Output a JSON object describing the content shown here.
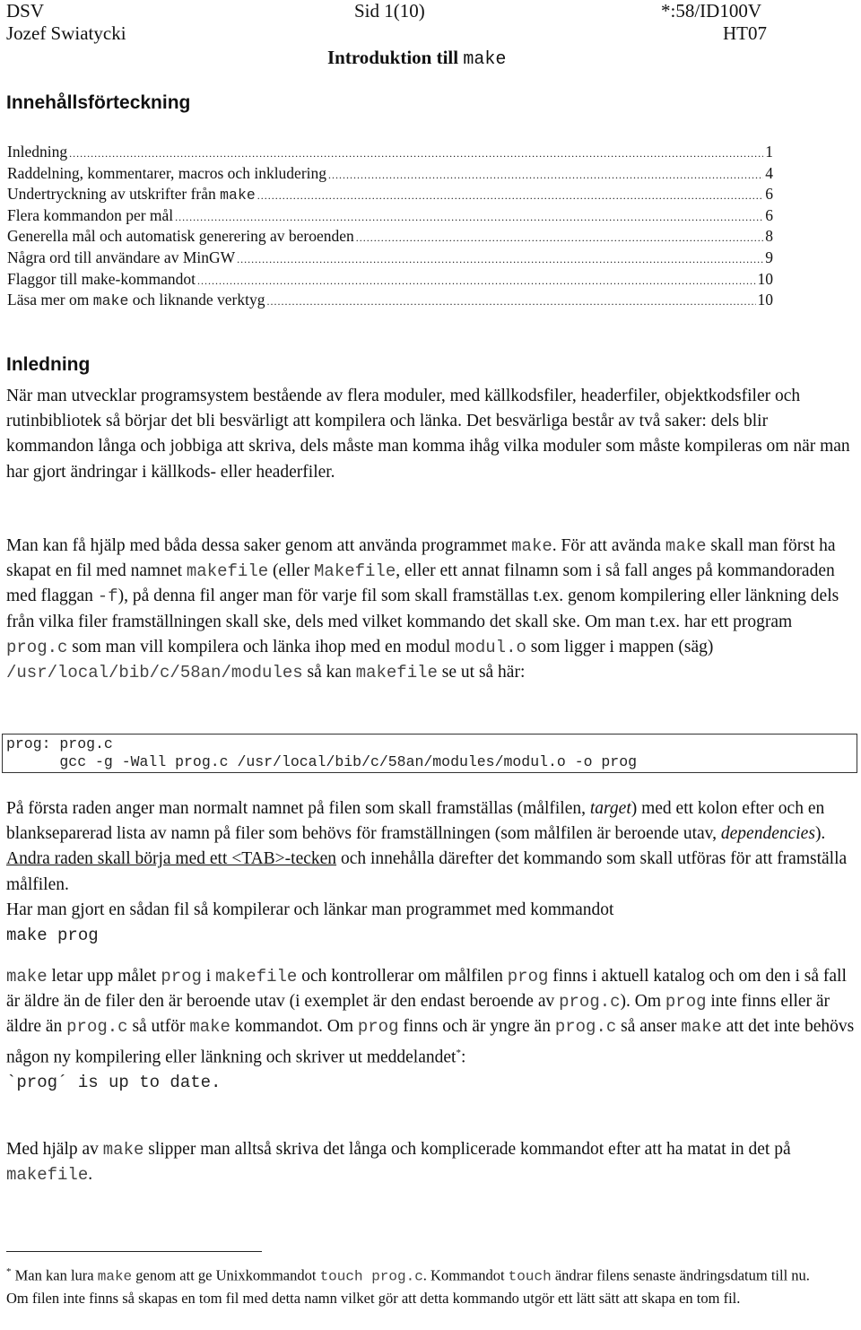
{
  "header": {
    "left_line1": "DSV",
    "center_line1": "Sid 1(10)",
    "right_line1": "*:58/ID100V",
    "left_line2": "Jozef Swiatycki",
    "right_line2": "HT07",
    "title_text": "Introduktion till ",
    "title_code": "make"
  },
  "toc": {
    "heading": "Innehållsförteckning",
    "dots": "..................................................................................................................................................................................................................................................",
    "items": [
      {
        "label": "Inledning",
        "page": "1"
      },
      {
        "label": "Raddelning, kommentarer, macros och inkludering",
        "page": "4"
      },
      {
        "label_pre": "Undertryckning av utskrifter från ",
        "label_code": "make",
        "page": "6"
      },
      {
        "label": "Flera kommandon per mål",
        "page": "6"
      },
      {
        "label": "Generella mål och automatisk generering av beroenden",
        "page": "8"
      },
      {
        "label": "Några ord till användare av MinGW",
        "page": "9"
      },
      {
        "label": "Flaggor till make-kommandot",
        "page": "10"
      },
      {
        "label_pre": "Läsa mer om ",
        "label_code": "make",
        "label_post": " och liknande verktyg",
        "page": "10"
      }
    ]
  },
  "section": {
    "heading": "Inledning",
    "p1": "När man utvecklar programsystem bestående av flera moduler, med källkodsfiler, headerfiler, objektkodsfiler och rutinbibliotek så börjar det bli besvärligt att kompilera och länka. Det besvärliga består av två saker: dels blir kommandon långa och jobbiga att skriva, dels måste man komma ihåg vilka moduler som måste kompileras om när man har gjort ändringar i källkods- eller headerfiler.",
    "p2": {
      "t1": "Man kan få hjälp med båda dessa saker genom att använda programmet ",
      "c1": "make",
      "t2": ". För att avända ",
      "c2": "make",
      "t3": " skall man först ha skapat en fil med namnet ",
      "c3": "makefile",
      "t4": " (eller ",
      "c4": "Makefile",
      "t5": ", eller ett annat filnamn som i så fall anges på kommandoraden med flaggan ",
      "c5": "-f",
      "t6": "),  på denna fil anger man för varje fil som skall framställas t.ex. genom kompilering eller länkning dels från vilka filer framställningen skall ske, dels med vilket kommando det skall ske. Om man t.ex. har ett program ",
      "c6": "prog.c",
      "t7": " som man vill kompilera och länka ihop med en modul ",
      "c7": "modul.o",
      "t8": " som ligger i mappen (säg) ",
      "c8": "/usr/local/bib/c/58an/modules",
      "t9": " så kan ",
      "c9": "makefile",
      "t10": " se ut så här:"
    },
    "code_lines": [
      "prog: prog.c",
      "      gcc -g -Wall prog.c /usr/local/bib/c/58an/modules/modul.o -o prog"
    ],
    "p3": {
      "t1": "På första raden anger man normalt namnet på filen som skall framställas (målfilen, ",
      "i1": "target",
      "t2": ") med ett kolon efter och en blankseparerad lista av namn på filer som behövs för framställningen (som målfilen är beroende utav, ",
      "i2": "dependencies",
      "t3": "). ",
      "u1": "Andra raden skall börja med ett <TAB>-tecken",
      "t4": " och innehålla därefter det kommando som skall utföras för att framställa målfilen.",
      "t5": "Har man gjort en sådan fil så kompilerar och länkar man programmet med kommandot",
      "cmd": "make prog"
    },
    "p4": {
      "c1": "make",
      "t1": " letar upp målet ",
      "c2": "prog",
      "t2": " i ",
      "c3": "makefile",
      "t3": " och kontrollerar om målfilen ",
      "c4": "prog",
      "t4": " finns i aktuell katalog och om den i så fall är äldre än de filer den är beroende utav (i exemplet är den endast beroende av ",
      "c5": "prog.c",
      "t5": "). Om ",
      "c6": "prog",
      "t6": " inte finns eller är äldre än ",
      "c7": "prog.c",
      "t7": " så utför ",
      "c8": "make",
      "t8": " kommandot. Om ",
      "c9": "prog",
      "t9": " finns och är yngre än ",
      "c10": "prog.c",
      "t10": " så anser ",
      "c11": "make",
      "t11": " att det inte behövs någon ny kompilering eller länkning och skriver ut meddelandet",
      "sup": "*",
      "t12": ":",
      "msg": "`prog´ is up to date."
    },
    "p5": {
      "t1": "Med hjälp av ",
      "c1": "make",
      "t2": " slipper man alltså skriva det långa och komplicerade kommandot efter att ha matat in det på ",
      "c2": "makefile",
      "t3": "."
    }
  },
  "footnote": {
    "marker": "*",
    "t1": " Man kan lura ",
    "c1": "make",
    "t2": " genom att ge Unixkommandot ",
    "c2": "touch prog.c",
    "t3": ". Kommandot ",
    "c3": "touch",
    "t4": " ändrar filens senaste ändringsdatum till nu. Om filen inte finns så skapas en tom fil med detta namn vilket gör att detta kommando utgör ett lätt sätt att skapa en tom fil."
  }
}
